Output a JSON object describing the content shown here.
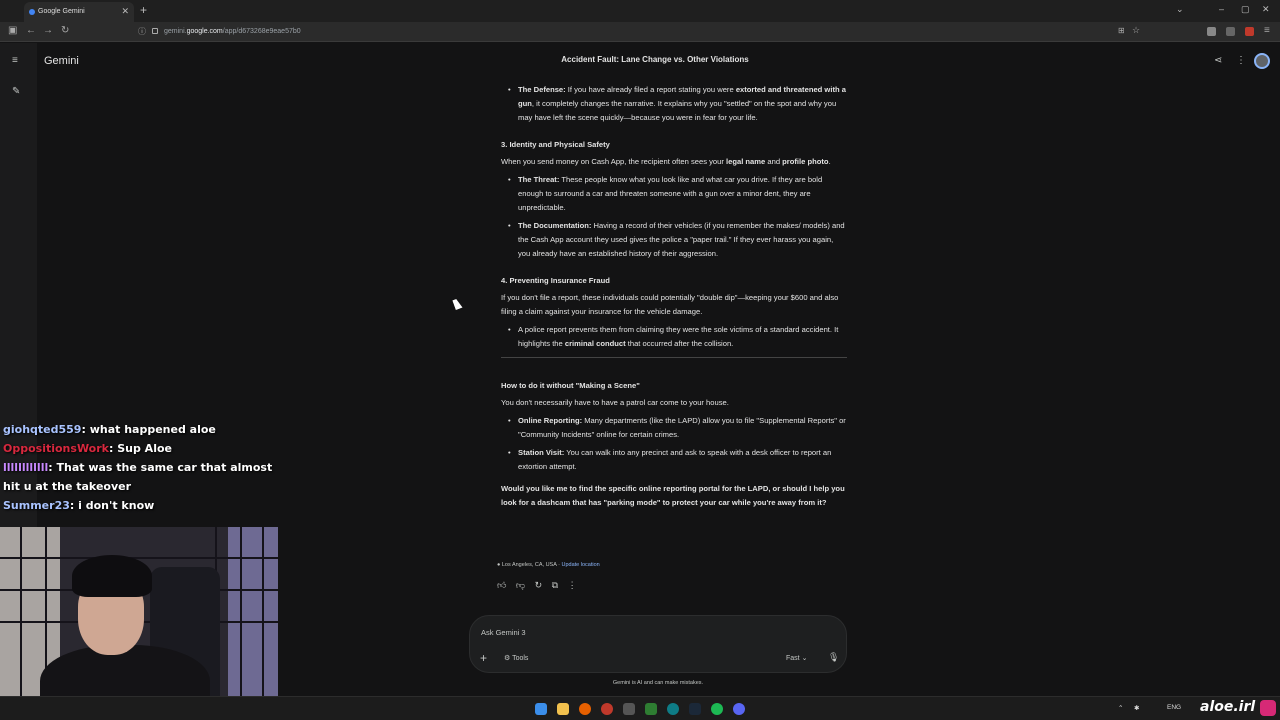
{
  "browser": {
    "tab_title": "Google Gemini",
    "url_prefix": "gemini.",
    "url_domain": "google.com",
    "url_path": "/app/d673268e9eae57b0"
  },
  "app": {
    "brand": "Gemini",
    "conversation_title": "Accident Fault: Lane Change vs. Other Violations"
  },
  "content": {
    "defense_label": "The Defense:",
    "defense_text1": " If you have already filed a report stating you were ",
    "defense_bold": "extorted and threatened with a gun",
    "defense_text2": ", it completely changes the narrative. It explains why you \"settled\" on the spot and why you may have left the scene quickly—because you were in fear for your life.",
    "section3_title": "3. Identity and Physical Safety",
    "section3_p1": "When you send money on Cash App, the recipient often sees your ",
    "section3_b1": "legal name",
    "section3_and": " and ",
    "section3_b2": "profile photo",
    "section3_end": ".",
    "threat_label": "The Threat:",
    "threat_text": " These people know what you look like and what car you drive. If they are bold enough to surround a car and threaten someone with a gun over a minor dent, they are unpredictable.",
    "doc_label": "The Documentation:",
    "doc_text": " Having a record of their vehicles (if you remember the makes/ models) and the Cash App account they used gives the police a \"paper trail.\" If they ever harass you again, you already have an established history of their aggression.",
    "section4_title": "4. Preventing Insurance Fraud",
    "section4_p": "If you don't file a report, these individuals could potentially \"double dip\"—keeping your $600 and also filing a claim against your insurance for the vehicle damage.",
    "section4_li1": "A police report prevents them from claiming they were the sole victims of a standard accident. It highlights the ",
    "section4_li_bold": "criminal conduct",
    "section4_li2": " that occurred after the collision.",
    "howto_title": "How to do it without \"Making a Scene\"",
    "howto_p": "You don't necessarily have to have a patrol car come to your house.",
    "online_label": "Online Reporting:",
    "online_text": " Many departments (like the LAPD) allow you to file \"Supplemental Reports\" or \"Community Incidents\" online for certain crimes.",
    "station_label": "Station Visit:",
    "station_text": " You can walk into any precinct and ask to speak with a desk officer to report an extortion attempt.",
    "question": "Would you like me to find the specific online reporting portal for the LAPD, or should I help you look for a dashcam that has \"parking mode\" to protect your car while you're away from it?"
  },
  "location": {
    "place": "Los Angeles, CA, USA",
    "update": "Update location"
  },
  "input": {
    "placeholder": "Ask Gemini 3",
    "tools": "Tools",
    "mode": "Fast",
    "disclaimer": "Gemini is AI and can make mistakes."
  },
  "chat_overlay": [
    {
      "user": "giohqted559",
      "message": "what happened aloe"
    },
    {
      "user": "OppositionsWork",
      "message": "Sup Aloe"
    },
    {
      "user": "llllllllllll",
      "message": "That was the same car that almost hit u at the takeover"
    },
    {
      "user": "Summer23",
      "message": "i don't know"
    }
  ],
  "taskbar": {
    "lang": "ENG",
    "brand": "aloe.irl"
  },
  "colors": {
    "background": "#131314",
    "accent_link": "#8ab4f8"
  }
}
